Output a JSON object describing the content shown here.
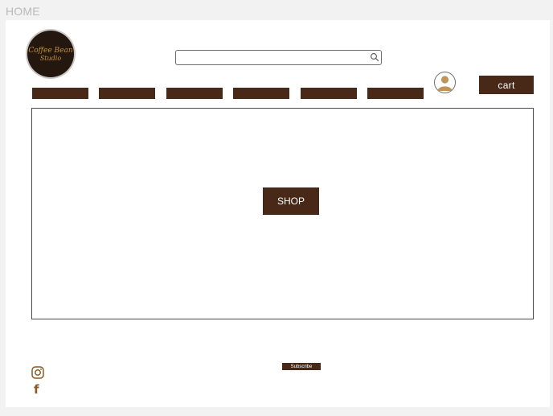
{
  "page": {
    "label": "HOME"
  },
  "header": {
    "logo": {
      "line1": "Coffee Bean",
      "line2": "Studio"
    },
    "search": {
      "value": "",
      "placeholder": "",
      "icon": "search-icon"
    },
    "avatar_icon": "user-icon",
    "cart_label": "cart"
  },
  "nav": {
    "items": [
      "",
      "",
      "",
      "",
      "",
      ""
    ]
  },
  "hero": {
    "button_label": "SHOP"
  },
  "footer": {
    "subscribe_label": "Subscribe",
    "social": [
      "instagram-icon",
      "facebook-icon"
    ]
  },
  "colors": {
    "brand_brown": "#482917",
    "logo_gold": "#c4923f",
    "icon_brown": "#8a5a24",
    "avatar_tan": "#c29357"
  }
}
